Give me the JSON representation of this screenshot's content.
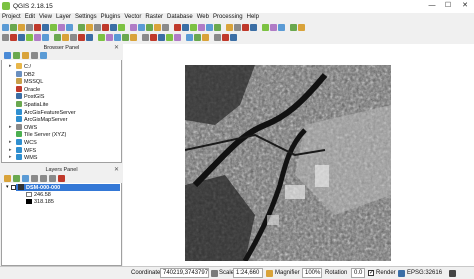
{
  "window": {
    "title": "QGIS 2.18.15",
    "minimize": "—",
    "maximize": "☐",
    "close": "✕"
  },
  "menu": [
    "Project",
    "Edit",
    "View",
    "Layer",
    "Settings",
    "Plugins",
    "Vector",
    "Raster",
    "Database",
    "Web",
    "Processing",
    "Help"
  ],
  "browser_panel": {
    "title": "Browser Panel",
    "items": [
      {
        "label": "C:/",
        "icon": "folder-icon",
        "color": "#e8b64a",
        "expandable": true
      },
      {
        "label": "DB2",
        "icon": "db2-icon",
        "color": "#6a8fbf",
        "expandable": false
      },
      {
        "label": "MSSQL",
        "icon": "mssql-icon",
        "color": "#c9a04a",
        "expandable": false
      },
      {
        "label": "Oracle",
        "icon": "oracle-icon",
        "color": "#c0392b",
        "expandable": false
      },
      {
        "label": "PostGIS",
        "icon": "postgis-icon",
        "color": "#3b6ea5",
        "expandable": false
      },
      {
        "label": "SpatiaLite",
        "icon": "spatialite-icon",
        "color": "#6aa84f",
        "expandable": false
      },
      {
        "label": "ArcGisFeatureServer",
        "icon": "arcgis-feature-icon",
        "color": "#2f8fd0",
        "expandable": false
      },
      {
        "label": "ArcGisMapServer",
        "icon": "arcgis-map-icon",
        "color": "#2f8fd0",
        "expandable": false
      },
      {
        "label": "OWS",
        "icon": "ows-icon",
        "color": "#8a8a8a",
        "expandable": true
      },
      {
        "label": "Tile Server (XYZ)",
        "icon": "xyz-icon",
        "color": "#4caf50",
        "expandable": false
      },
      {
        "label": "WCS",
        "icon": "wcs-icon",
        "color": "#2f8fd0",
        "expandable": true
      },
      {
        "label": "WFS",
        "icon": "wfs-icon",
        "color": "#2f8fd0",
        "expandable": true
      },
      {
        "label": "WMS",
        "icon": "wms-icon",
        "color": "#2f8fd0",
        "expandable": true
      }
    ]
  },
  "layers_panel": {
    "title": "Layers Panel",
    "layer": {
      "name": "DSM-000-000",
      "checked": true
    },
    "legend": {
      "max": "246.58",
      "min": "318.185"
    }
  },
  "status": {
    "coordinate_label": "Coordinate",
    "coordinate": "740219,3743797",
    "scale_label": "Scale",
    "scale": "1:24,660",
    "magnifier_label": "Magnifier",
    "magnifier": "100%",
    "rotation_label": "Rotation",
    "rotation": "0.0",
    "render_label": "Render",
    "render_checked": true,
    "crs": "EPSG:32616"
  },
  "colors": {
    "selection": "#3478d6",
    "accent": "#7cc242"
  }
}
